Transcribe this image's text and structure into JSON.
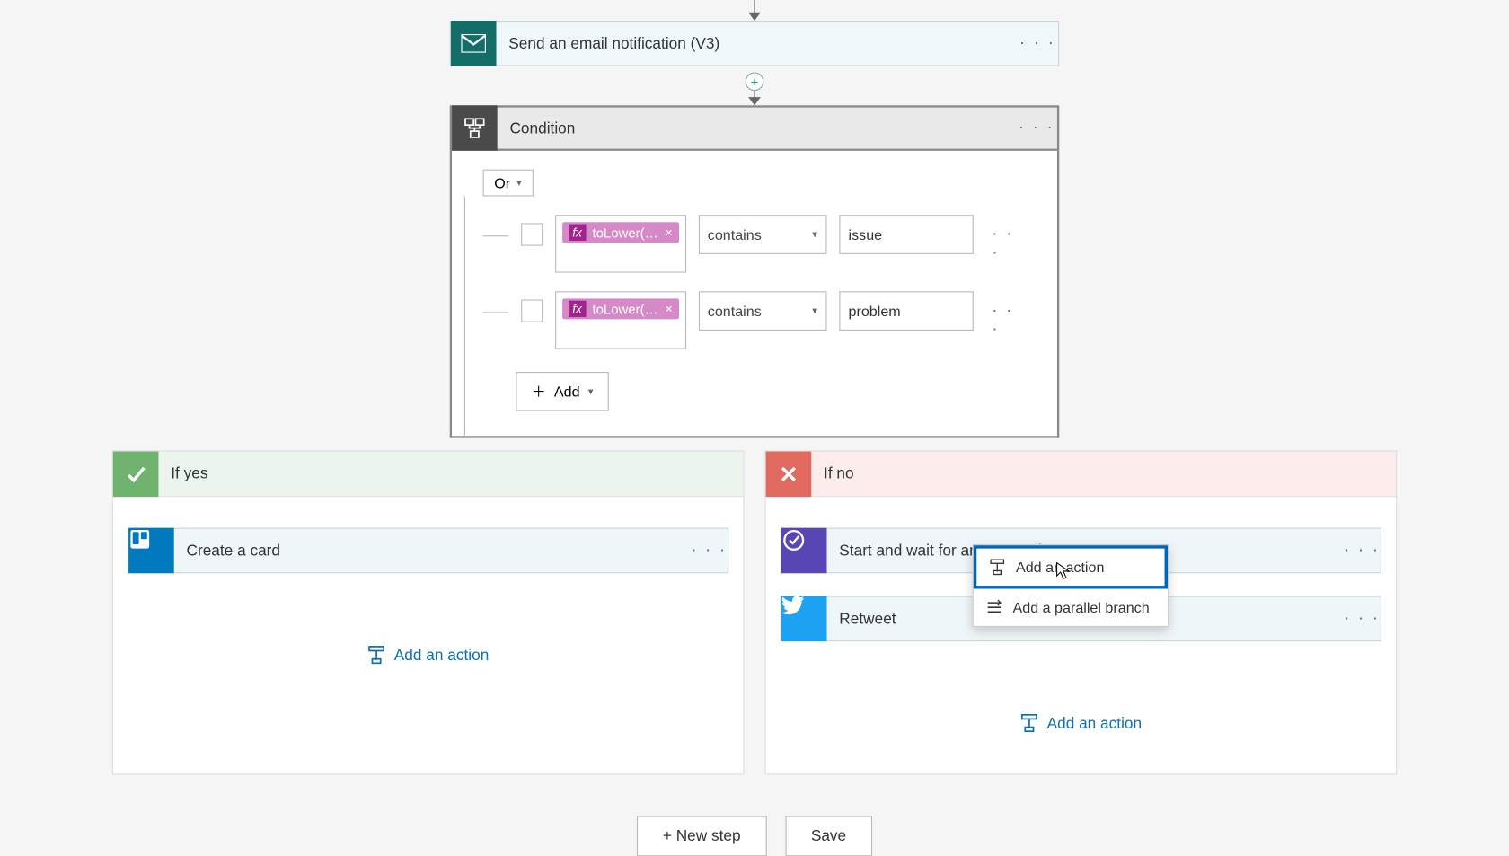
{
  "actions": {
    "email": "Send an email notification (V3)",
    "condition": "Condition",
    "trello": "Create a card",
    "approval": "Start and wait for an approval",
    "retweet": "Retweet"
  },
  "condition": {
    "group_op": "Or",
    "operator": "contains",
    "token_label": "toLower(…",
    "values": {
      "row1": "issue",
      "row2": "problem"
    },
    "add_label": "Add"
  },
  "branches": {
    "yes": "If yes",
    "no": "If no"
  },
  "links": {
    "add_action": "Add an action",
    "add_parallel": "Add a parallel branch"
  },
  "footer": {
    "new_step": "+ New step",
    "save": "Save"
  },
  "more": "· · ·"
}
